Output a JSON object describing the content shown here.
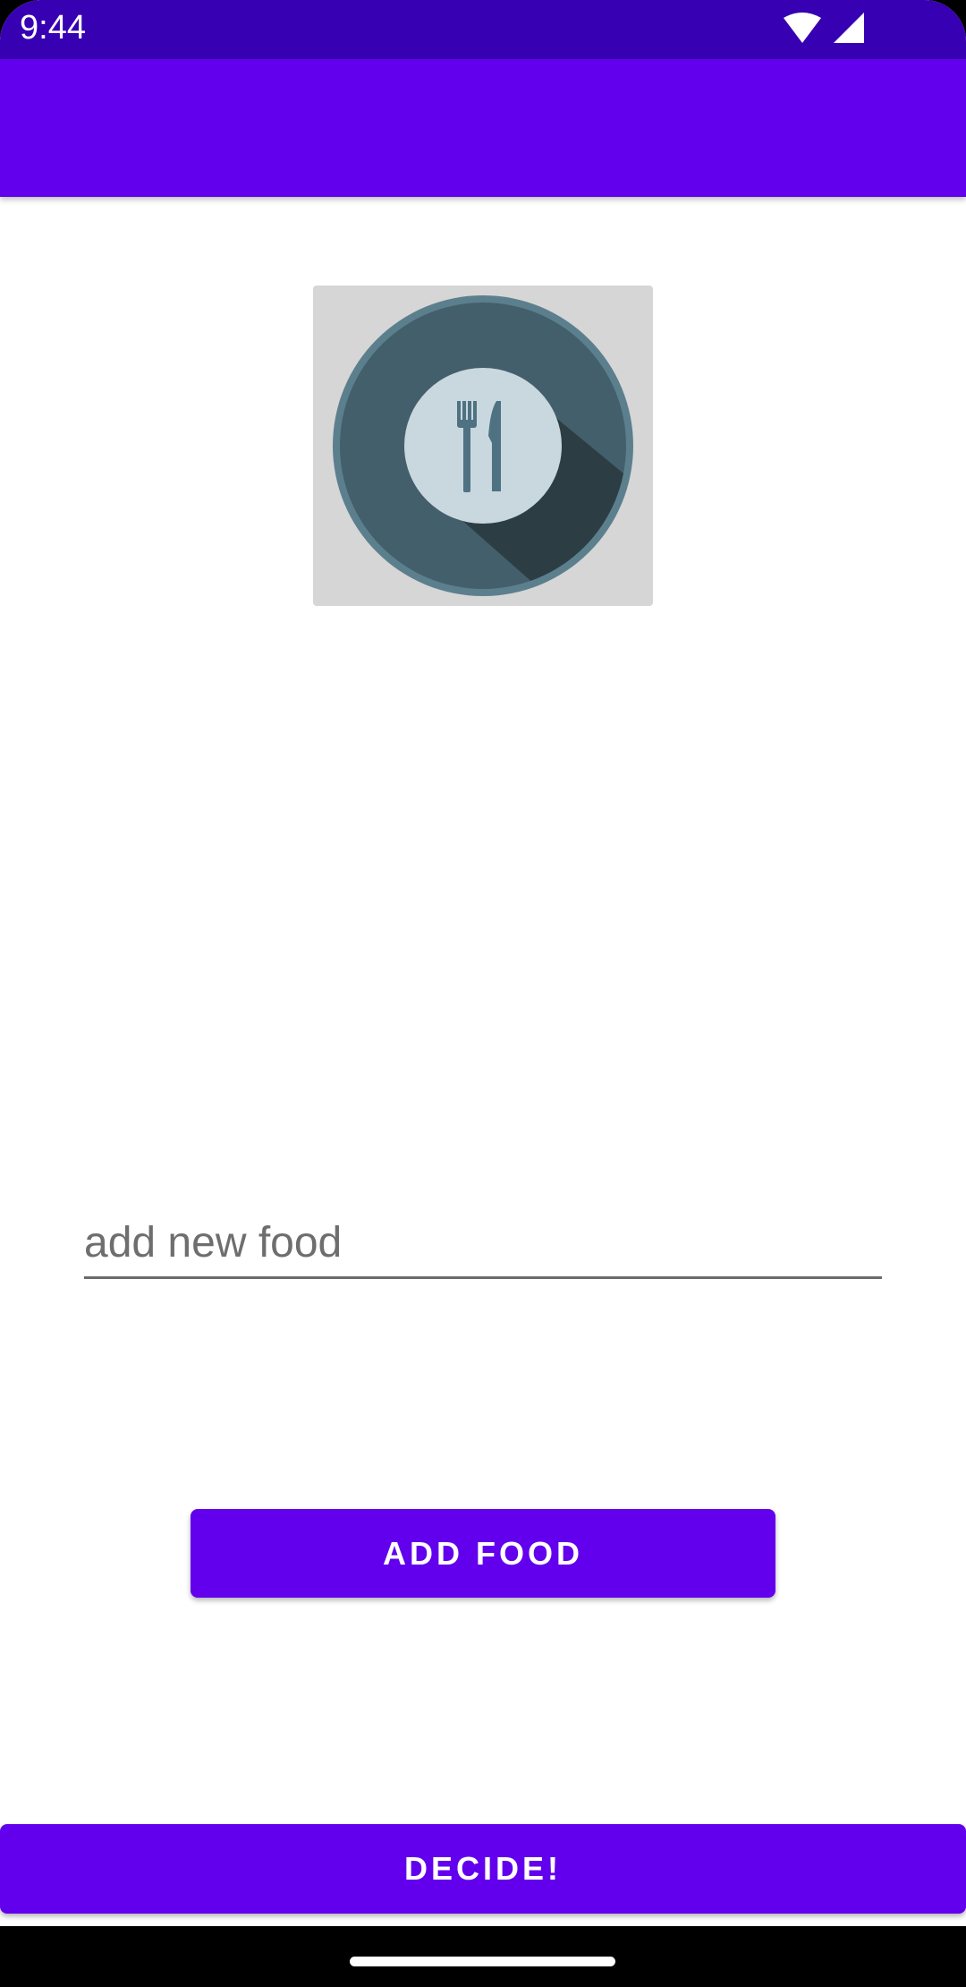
{
  "status_bar": {
    "time": "9:44",
    "icons": [
      "wifi-icon",
      "cell-signal-icon"
    ]
  },
  "app_bar": {
    "title": ""
  },
  "food_image": {
    "icon": "plate-fork-knife-icon"
  },
  "food_input": {
    "value": "",
    "placeholder": "add new food"
  },
  "add_food_button": {
    "label": "ADD FOOD"
  },
  "decide_button": {
    "label": "DECIDE!"
  },
  "colors": {
    "status_bar": "#3700b3",
    "primary": "#6200ee",
    "background": "#ffffff",
    "image_background": "#d6d6d6"
  }
}
